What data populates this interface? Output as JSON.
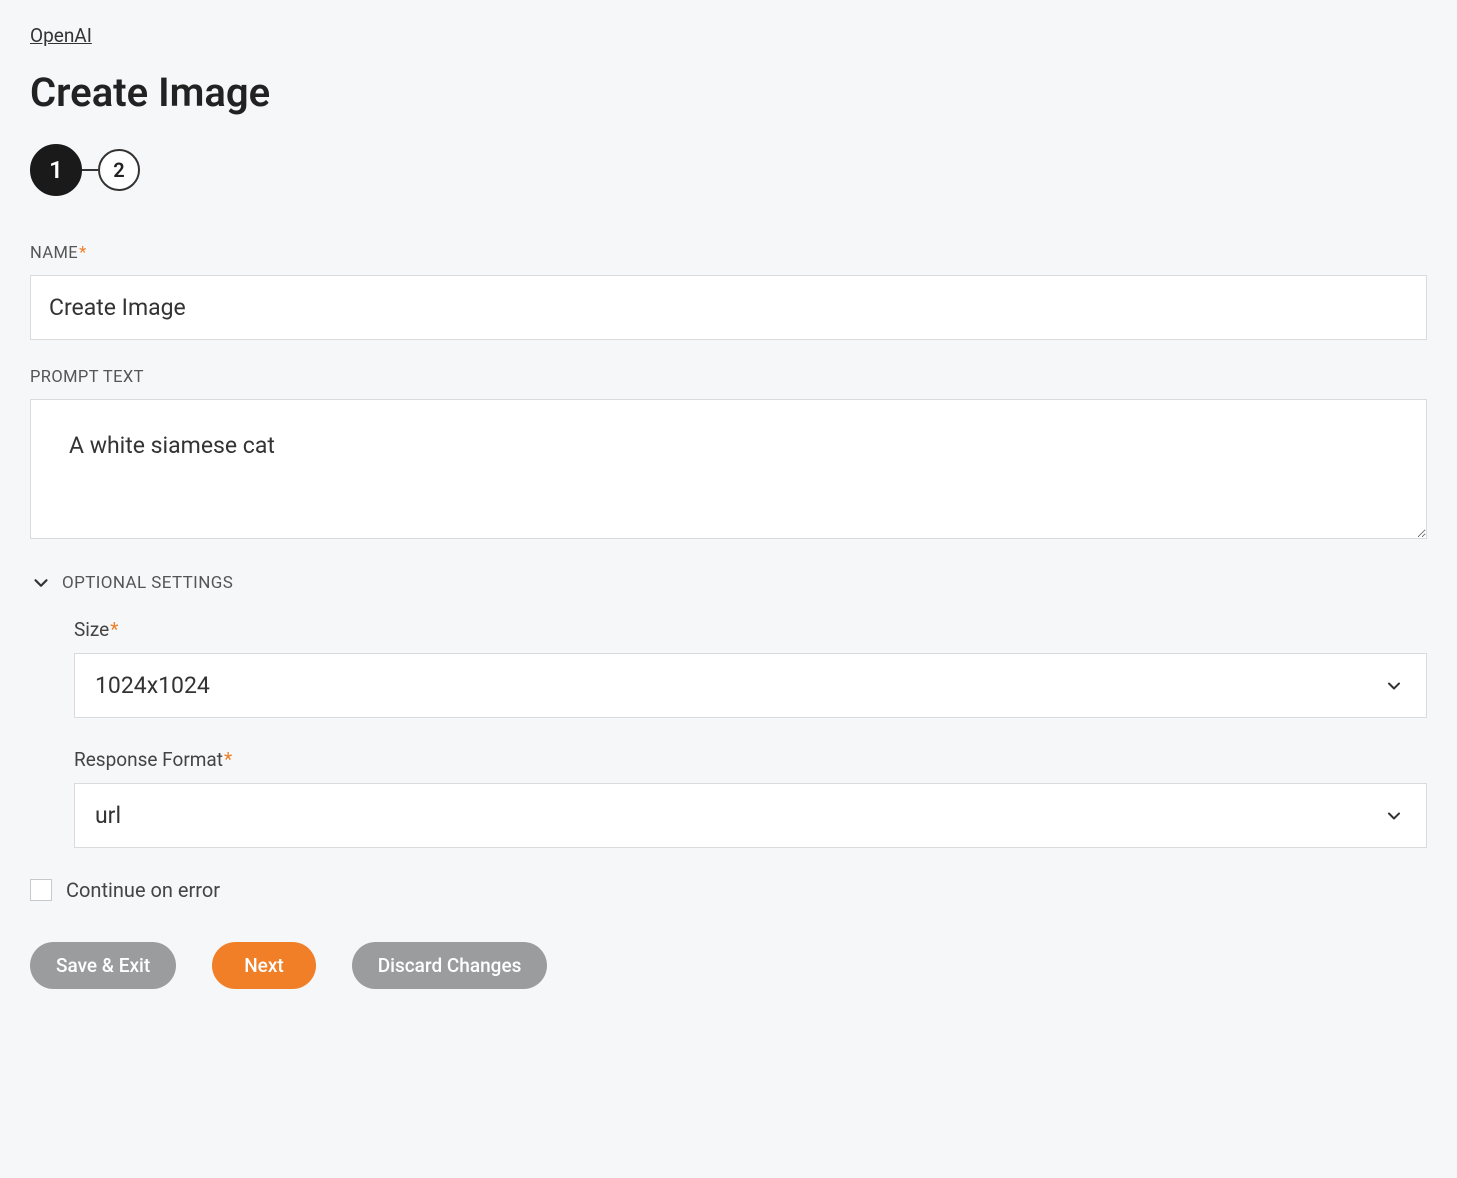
{
  "breadcrumb": "OpenAI",
  "page_title": "Create Image",
  "stepper": {
    "steps": [
      "1",
      "2"
    ],
    "active_index": 0
  },
  "fields": {
    "name": {
      "label": "NAME",
      "value": "Create Image",
      "required": true
    },
    "prompt": {
      "label": "PROMPT TEXT",
      "value": "A white siamese cat",
      "required": false
    }
  },
  "optional": {
    "header": "OPTIONAL SETTINGS",
    "size": {
      "label": "Size",
      "value": "1024x1024",
      "required": true
    },
    "response_format": {
      "label": "Response Format",
      "value": "url",
      "required": true
    }
  },
  "continue_on_error": {
    "label": "Continue on error",
    "checked": false
  },
  "buttons": {
    "save_exit": "Save & Exit",
    "next": "Next",
    "discard": "Discard Changes"
  },
  "required_marker": "*"
}
